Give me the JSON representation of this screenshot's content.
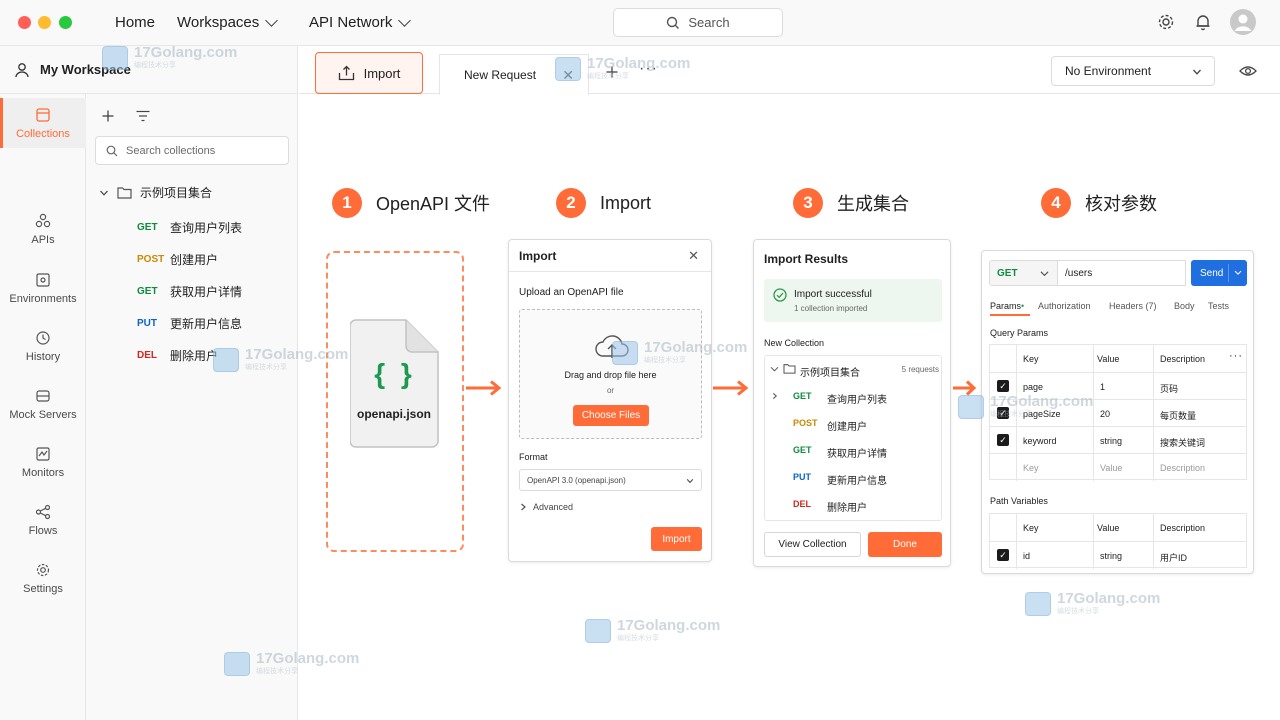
{
  "titlebar": {
    "nav": [
      {
        "label": "Home"
      },
      {
        "label": "Workspaces"
      },
      {
        "label": "API Network"
      }
    ],
    "search_label": "Search"
  },
  "sidebar": {
    "workspace": "My Workspace",
    "rail": [
      {
        "label": "Collections",
        "icon": "collections-icon",
        "active": true
      },
      {
        "label": "APIs",
        "icon": "apis-icon"
      },
      {
        "label": "Environments",
        "icon": "environments-icon"
      },
      {
        "label": "History",
        "icon": "history-icon"
      },
      {
        "label": "Mock Servers",
        "icon": "mock-servers-icon"
      },
      {
        "label": "Monitors",
        "icon": "monitors-icon"
      },
      {
        "label": "Flows",
        "icon": "flows-icon"
      },
      {
        "label": "Settings",
        "icon": "settings-icon"
      }
    ],
    "search_placeholder": "Search collections",
    "collection": {
      "name": "示例项目集合",
      "requests": [
        {
          "method": "GET",
          "name": "查询用户列表"
        },
        {
          "method": "POST",
          "name": "创建用户"
        },
        {
          "method": "GET",
          "name": "获取用户详情"
        },
        {
          "method": "PUT",
          "name": "更新用户信息"
        },
        {
          "method": "DEL",
          "name": "删除用户"
        }
      ]
    }
  },
  "tabs": {
    "import_label": "Import",
    "request_tab": "New Request",
    "more": "···",
    "environment": "No Environment"
  },
  "steps": [
    {
      "num": "1",
      "title": "OpenAPI 文件"
    },
    {
      "num": "2",
      "title": "Import"
    },
    {
      "num": "3",
      "title": "生成集合"
    },
    {
      "num": "4",
      "title": "核对参数"
    }
  ],
  "file": {
    "name": "openapi.json",
    "glyph": "{ }"
  },
  "import_dialog": {
    "title": "Import",
    "upload_label": "Upload an OpenAPI file",
    "drop_text": "Drag and drop file here",
    "or": "or",
    "choose_files": "Choose Files",
    "format_label": "Format",
    "format_value": "OpenAPI 3.0 (openapi.json)",
    "advanced": "Advanced",
    "import_button": "Import"
  },
  "results": {
    "title": "Import Results",
    "success_title": "Import successful",
    "success_sub": "1 collection imported",
    "new_collection_label": "New Collection",
    "collection_name": "示例项目集合",
    "count": "5 requests",
    "requests": [
      {
        "method": "GET",
        "name": "查询用户列表"
      },
      {
        "method": "POST",
        "name": "创建用户"
      },
      {
        "method": "GET",
        "name": "获取用户详情"
      },
      {
        "method": "PUT",
        "name": "更新用户信息"
      },
      {
        "method": "DEL",
        "name": "删除用户"
      }
    ],
    "view_button": "View Collection",
    "done_button": "Done"
  },
  "request_panel": {
    "method": "GET",
    "url": "/users",
    "send": "Send",
    "tabs": [
      "Params",
      "Authorization",
      "Headers (7)",
      "Body",
      "Tests"
    ],
    "query_label": "Query Params",
    "columns": [
      "Key",
      "Value",
      "Description"
    ],
    "query_rows": [
      {
        "key": "page",
        "value": "1",
        "desc": "页码"
      },
      {
        "key": "pageSize",
        "value": "20",
        "desc": "每页数量"
      },
      {
        "key": "keyword",
        "value": "string",
        "desc": "搜索关键词"
      }
    ],
    "placeholder_row": {
      "key": "Key",
      "value": "Value",
      "desc": "Description"
    },
    "path_label": "Path Variables",
    "path_rows": [
      {
        "key": "id",
        "value": "string",
        "desc": "用户ID"
      }
    ]
  },
  "watermark": {
    "text": "17Golang.com",
    "sub": "编程技术分享"
  },
  "colors": {
    "accent": "#ff6c37",
    "get": "#0f8b3f",
    "post": "#c98a00",
    "put": "#0c63c7",
    "del": "#d0281e",
    "send": "#1f6fe0"
  }
}
